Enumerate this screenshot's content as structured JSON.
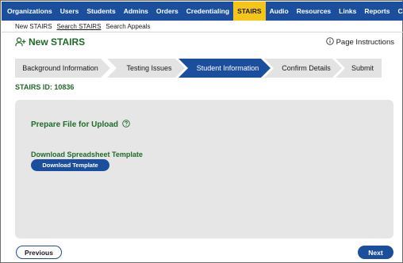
{
  "topnav": {
    "items": [
      {
        "label": "Organizations"
      },
      {
        "label": "Users"
      },
      {
        "label": "Students"
      },
      {
        "label": "Admins"
      },
      {
        "label": "Orders"
      },
      {
        "label": "Credentialing"
      },
      {
        "label": "STAIRS",
        "active": true
      },
      {
        "label": "Audio"
      },
      {
        "label": "Resources"
      },
      {
        "label": "Links"
      },
      {
        "label": "Reports"
      },
      {
        "label": "CARS"
      }
    ]
  },
  "subnav": {
    "items": [
      {
        "label": "New STAIRS"
      },
      {
        "label": "Search STAIRS",
        "active": true
      },
      {
        "label": "Search Appeals"
      }
    ]
  },
  "header": {
    "title": "New STAIRS",
    "title_icon": "add-user-icon",
    "instructions_label": "Page Instructions",
    "instructions_icon": "info-circle-icon"
  },
  "wizard": {
    "steps": [
      {
        "label": "Background Information"
      },
      {
        "label": "Testing Issues"
      },
      {
        "label": "Student Information",
        "active": true
      },
      {
        "label": "Confirm Details"
      },
      {
        "label": "Submit"
      }
    ]
  },
  "stairs_id": "STAIRS ID: 10836",
  "panel": {
    "heading": "Prepare File for Upload",
    "help_icon": "question-circle-icon",
    "download_label": "Download Spreadsheet Template",
    "download_button": "Download Template"
  },
  "footer": {
    "previous": "Previous",
    "next": "Next"
  },
  "colors": {
    "nav_blue": "#1b4f9e",
    "active_yellow": "#f5c518",
    "accent_green": "#1e6b28",
    "panel_gray": "#e6e6e6",
    "step_gray": "#e3e3e3"
  }
}
